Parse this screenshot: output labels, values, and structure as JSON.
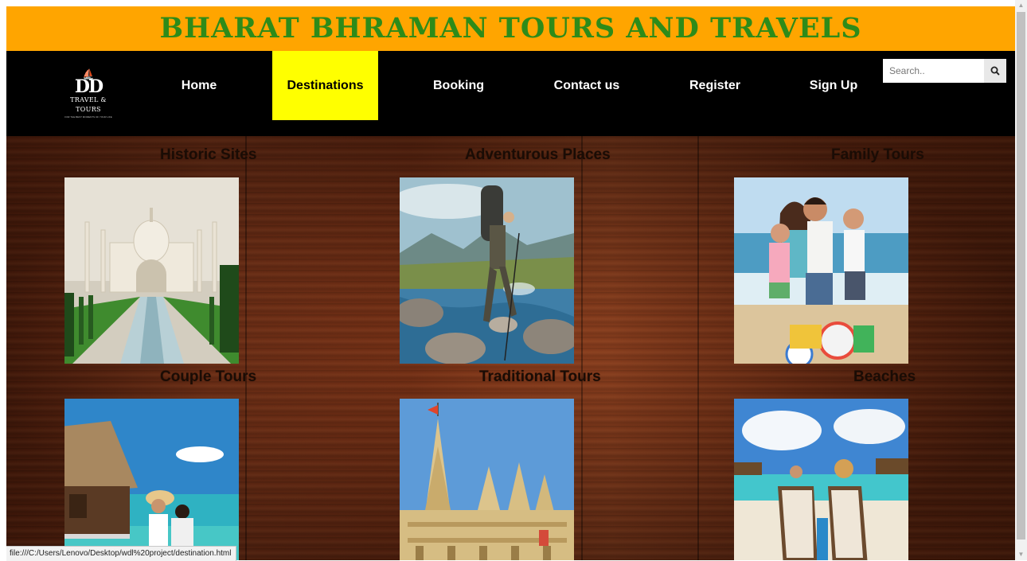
{
  "header": {
    "title": "BHARAT BHRAMAN TOURS AND TRAVELS"
  },
  "logo": {
    "mark": "DD",
    "line1": "TRAVEL & TOURS",
    "line2": "FOR THE BEST MOMENTS OF YOUR LIFE"
  },
  "nav": {
    "items": [
      {
        "label": "Home",
        "active": false
      },
      {
        "label": "Destinations",
        "active": true
      },
      {
        "label": "Booking",
        "active": false
      },
      {
        "label": "Contact us",
        "active": false
      },
      {
        "label": "Register",
        "active": false
      },
      {
        "label": "Sign Up",
        "active": false
      }
    ]
  },
  "search": {
    "placeholder": "Search..",
    "value": "",
    "icon": "search-icon"
  },
  "destinations": [
    {
      "title": "Historic Sites",
      "image": "taj-mahal"
    },
    {
      "title": "Adventurous Places",
      "image": "hiker-crossing-river"
    },
    {
      "title": "Family Tours",
      "image": "family-on-beach"
    },
    {
      "title": "Couple Tours",
      "image": "couple-at-water-villa"
    },
    {
      "title": "Traditional Tours",
      "image": "temple"
    },
    {
      "title": "Beaches",
      "image": "beach-chairs"
    }
  ],
  "status_bar": {
    "url": "file:///C:/Users/Lenovo/Desktop/wdl%20project/destination.html"
  },
  "colors": {
    "header_bg": "#ffa500",
    "title": "#2e8b19",
    "nav_bg": "#000000",
    "nav_active": "#ffff00",
    "wood": "#6b2a12"
  }
}
